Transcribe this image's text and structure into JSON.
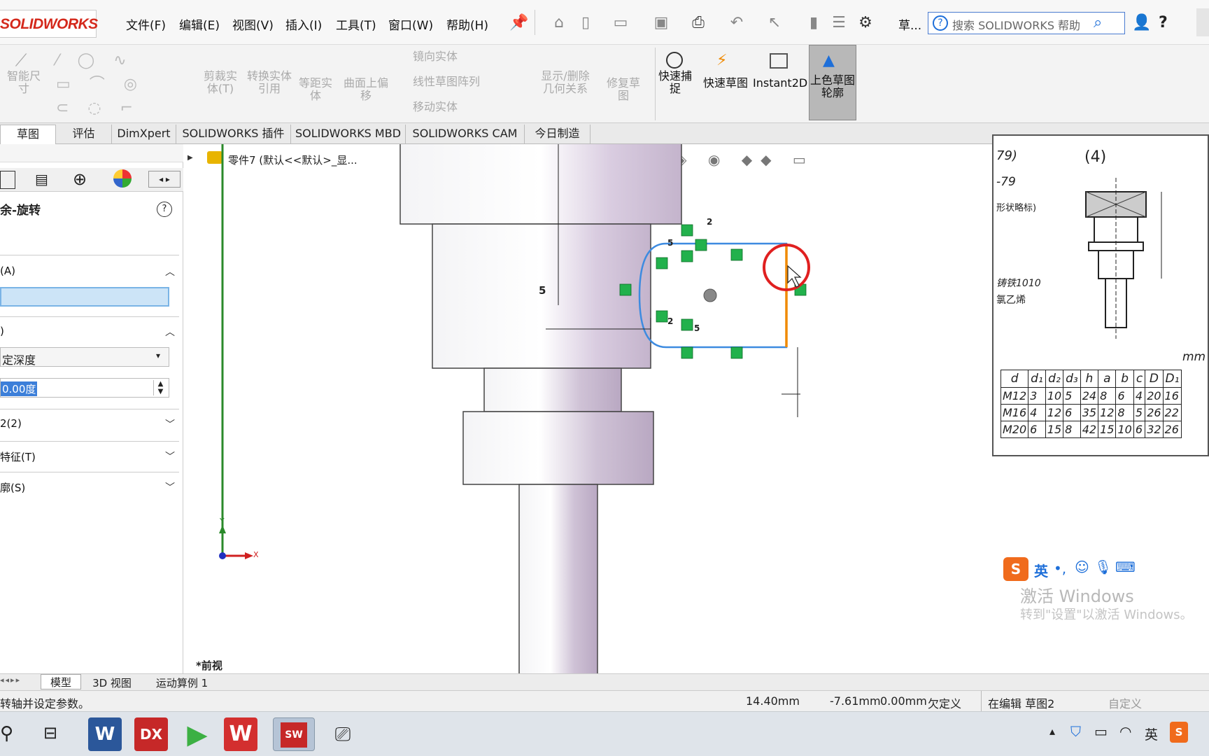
{
  "app": {
    "logo_text": "SOLIDWORKS"
  },
  "menu": [
    "文件(F)",
    "编辑(E)",
    "视图(V)",
    "插入(I)",
    "工具(T)",
    "窗口(W)",
    "帮助(H)"
  ],
  "toolbar_extra": {
    "sketch_short": "草...",
    "search_placeholder": "搜索 SOLIDWORKS 帮助",
    "help": "?"
  },
  "command_manager": {
    "smart_dim": "智能尺寸",
    "trim": "剪裁实体(T)",
    "convert": "转换实体引用",
    "offset": "等距实体",
    "surface_offset": "曲面上偏移",
    "mirror": "镜向实体",
    "linear_pattern": "线性草图阵列",
    "move": "移动实体",
    "display_relations": "显示/删除几何关系",
    "repair": "修复草图",
    "quick_snap": "快速捕捉",
    "rapid_sketch": "快速草图",
    "instant2d": "Instant2D",
    "shaded_contours": "上色草图轮廓"
  },
  "tabs": [
    "草图",
    "评估",
    "DimXpert",
    "SOLIDWORKS 插件",
    "SOLIDWORKS MBD",
    "SOLIDWORKS CAM",
    "今日制造"
  ],
  "property_manager": {
    "title": "余-旋转",
    "axis_section": "(A)",
    "dir_section": ")",
    "end_condition": "定深度",
    "angle_value": "0.00度",
    "dir2_section": "2(2)",
    "features_section": "特征(T)",
    "selected_section": "廓(S)"
  },
  "tree": {
    "part_label": "零件7 (默认<<默认>_显..."
  },
  "viewport": {
    "view_label": "*前视",
    "dim_horizontal": "5",
    "relation_labels": [
      "2",
      "5",
      "2",
      "5"
    ],
    "axis_y": "Y",
    "axis_x": "X"
  },
  "reference_image": {
    "label_top": "(4)",
    "label_left": "79)",
    "label_left2": "-79",
    "label_note1": "形状略标)",
    "label_note2": "铸铁1010",
    "label_note3": "氯乙烯",
    "unit": "mm",
    "table_headers": [
      "d",
      "d₁",
      "d₂",
      "d₃",
      "h",
      "a",
      "b",
      "c",
      "D",
      "D₁"
    ],
    "table_rows": [
      [
        "M12",
        "3",
        "10",
        "5",
        "24",
        "8",
        "6",
        "4",
        "20",
        "16"
      ],
      [
        "M16",
        "4",
        "12",
        "6",
        "35",
        "12",
        "8",
        "5",
        "26",
        "22"
      ],
      [
        "M20",
        "6",
        "15",
        "8",
        "42",
        "15",
        "10",
        "6",
        "32",
        "26"
      ]
    ]
  },
  "ime": {
    "lang": "英"
  },
  "watermark": {
    "line1": "激活 Windows",
    "line2": "转到\"设置\"以激活 Windows。"
  },
  "bottom_tabs": [
    "模型",
    "3D 视图",
    "运动算例 1"
  ],
  "status": {
    "hint": "转轴并设定参数。",
    "x": "14.40mm",
    "y": "-7.61mm",
    "z": "0.00mm",
    "state": "欠定义",
    "editing": "在编辑 草图2",
    "custom": "自定义"
  },
  "taskbar": {
    "tray_lang": "英"
  },
  "colors": {
    "accent": "#1e6fd9",
    "logo_red": "#d4281b",
    "sketch_blue": "#3d8be0",
    "orange": "#f08a00",
    "relation_green": "#22b14c",
    "highlight_red": "#e02020"
  }
}
